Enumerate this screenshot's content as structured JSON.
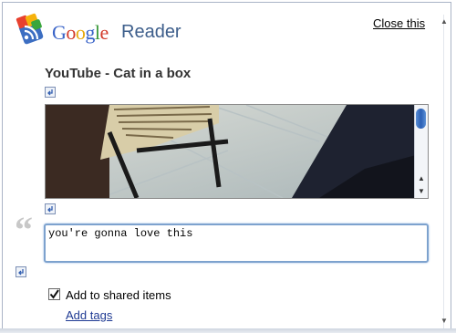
{
  "app": {
    "logo_google": "Google",
    "logo_reader": "Reader",
    "close_label": "Close this"
  },
  "item": {
    "title": "YouTube - Cat in a box"
  },
  "note": {
    "value": "you're gonna love this"
  },
  "share": {
    "checked": true,
    "label": "Add to shared items",
    "add_tags_label": "Add tags"
  },
  "colors": {
    "accent": "#1f3a93",
    "reader_blue": "#3d5e8b",
    "input_border": "#7da2ce",
    "scroll_thumb": "#2a5fb4"
  },
  "icons": {
    "logo": "google-reader-feed-icon",
    "mini": "insert-arrow-icon",
    "quote": "quote-mark-icon",
    "check": "checkmark-icon",
    "scroll_up": "chevron-up-icon",
    "scroll_down": "chevron-down-icon"
  }
}
